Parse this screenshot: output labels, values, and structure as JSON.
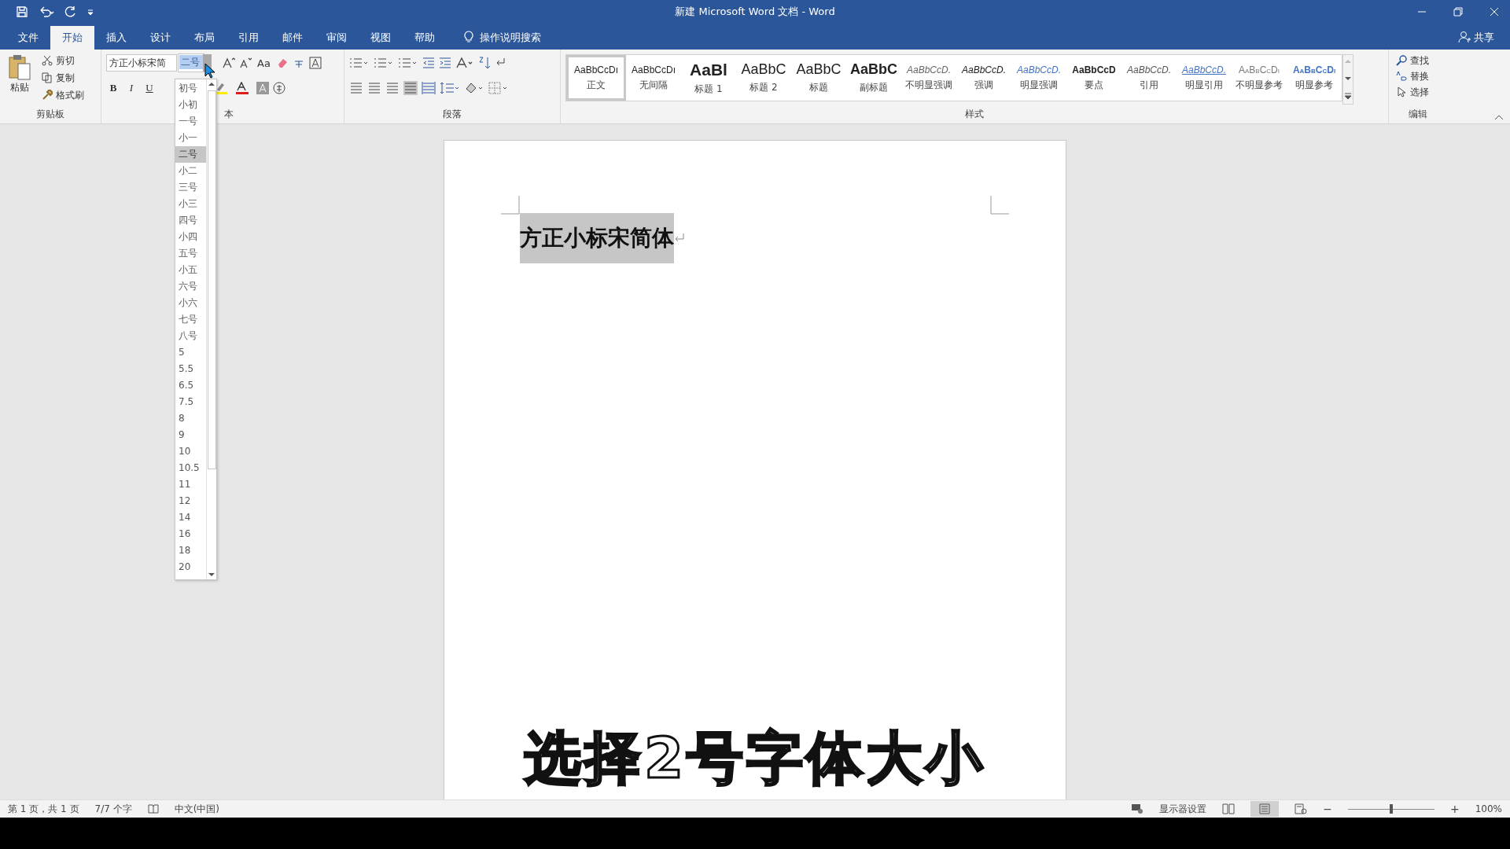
{
  "window": {
    "title": "新建 Microsoft Word 文档  -  Word",
    "share": "共享"
  },
  "tabs": [
    {
      "label": "文件",
      "selected": false
    },
    {
      "label": "开始",
      "selected": true
    },
    {
      "label": "插入",
      "selected": false
    },
    {
      "label": "设计",
      "selected": false
    },
    {
      "label": "布局",
      "selected": false
    },
    {
      "label": "引用",
      "selected": false
    },
    {
      "label": "邮件",
      "selected": false
    },
    {
      "label": "审阅",
      "selected": false
    },
    {
      "label": "视图",
      "selected": false
    },
    {
      "label": "帮助",
      "selected": false
    }
  ],
  "tell_me": "操作说明搜索",
  "clipboard": {
    "paste": "粘贴",
    "cut": "剪切",
    "copy": "复制",
    "format_painter": "格式刷",
    "label": "剪贴板"
  },
  "font": {
    "name": "方正小标宋简",
    "size": "二号",
    "change_case": "Aa",
    "bold": "B",
    "italic": "I",
    "underline": "U",
    "label": "本"
  },
  "paragraph": {
    "label": "段落"
  },
  "styles": {
    "label": "样式",
    "items": [
      {
        "preview": "AaBbCcDı",
        "name": "正文",
        "kind": "normal",
        "selected": true
      },
      {
        "preview": "AaBbCcDı",
        "name": "无间隔",
        "kind": "normal",
        "selected": false
      },
      {
        "preview": "AaBl",
        "name": "标题 1",
        "kind": "heading1",
        "selected": false
      },
      {
        "preview": "AaBbC",
        "name": "标题 2",
        "kind": "heading2",
        "selected": false
      },
      {
        "preview": "AaBbC",
        "name": "标题",
        "kind": "title",
        "selected": false
      },
      {
        "preview": "AaBbC",
        "name": "副标题",
        "kind": "subtitle",
        "selected": false
      },
      {
        "preview": "AaBbCcD.",
        "name": "不明显强调",
        "kind": "subtle_em",
        "selected": false
      },
      {
        "preview": "AaBbCcD.",
        "name": "强调",
        "kind": "emphasis",
        "selected": false
      },
      {
        "preview": "AaBbCcD.",
        "name": "明显强调",
        "kind": "intense_em",
        "selected": false
      },
      {
        "preview": "AaBbCcD",
        "name": "要点",
        "kind": "strong",
        "selected": false
      },
      {
        "preview": "AaBbCcD.",
        "name": "引用",
        "kind": "quote",
        "selected": false
      },
      {
        "preview": "AaBbCcD.",
        "name": "明显引用",
        "kind": "intense_quote",
        "selected": false
      },
      {
        "preview": "AaBbCcDı",
        "name": "不明显参考",
        "kind": "subtle_ref",
        "selected": false
      },
      {
        "preview": "AaBbCcDı",
        "name": "明显参考",
        "kind": "intense_ref",
        "selected": false
      }
    ]
  },
  "editing": {
    "find": "查找",
    "replace": "替换",
    "select": "选择",
    "label": "编辑"
  },
  "size_list": [
    {
      "label": "初号",
      "selected": false
    },
    {
      "label": "小初",
      "selected": false
    },
    {
      "label": "一号",
      "selected": false
    },
    {
      "label": "小一",
      "selected": false
    },
    {
      "label": "二号",
      "selected": true
    },
    {
      "label": "小二",
      "selected": false
    },
    {
      "label": "三号",
      "selected": false
    },
    {
      "label": "小三",
      "selected": false
    },
    {
      "label": "四号",
      "selected": false
    },
    {
      "label": "小四",
      "selected": false
    },
    {
      "label": "五号",
      "selected": false
    },
    {
      "label": "小五",
      "selected": false
    },
    {
      "label": "六号",
      "selected": false
    },
    {
      "label": "小六",
      "selected": false
    },
    {
      "label": "七号",
      "selected": false
    },
    {
      "label": "八号",
      "selected": false
    },
    {
      "label": "5",
      "selected": false
    },
    {
      "label": "5.5",
      "selected": false
    },
    {
      "label": "6.5",
      "selected": false
    },
    {
      "label": "7.5",
      "selected": false
    },
    {
      "label": "8",
      "selected": false
    },
    {
      "label": "9",
      "selected": false
    },
    {
      "label": "10",
      "selected": false
    },
    {
      "label": "10.5",
      "selected": false
    },
    {
      "label": "11",
      "selected": false
    },
    {
      "label": "12",
      "selected": false
    },
    {
      "label": "14",
      "selected": false
    },
    {
      "label": "16",
      "selected": false
    },
    {
      "label": "18",
      "selected": false
    },
    {
      "label": "20",
      "selected": false
    }
  ],
  "document": {
    "text": "方正小标宋简体",
    "selected": true
  },
  "caption": "选择2号字体大小",
  "status_bar": {
    "page": "第 1 页，共 1 页",
    "words": "7/7 个字",
    "language": "中文(中国)",
    "display": "显示器设置",
    "zoom": "100%",
    "zoom_out": "−",
    "zoom_in": "+",
    "zoom_slider": {
      "level": 0.5
    }
  }
}
